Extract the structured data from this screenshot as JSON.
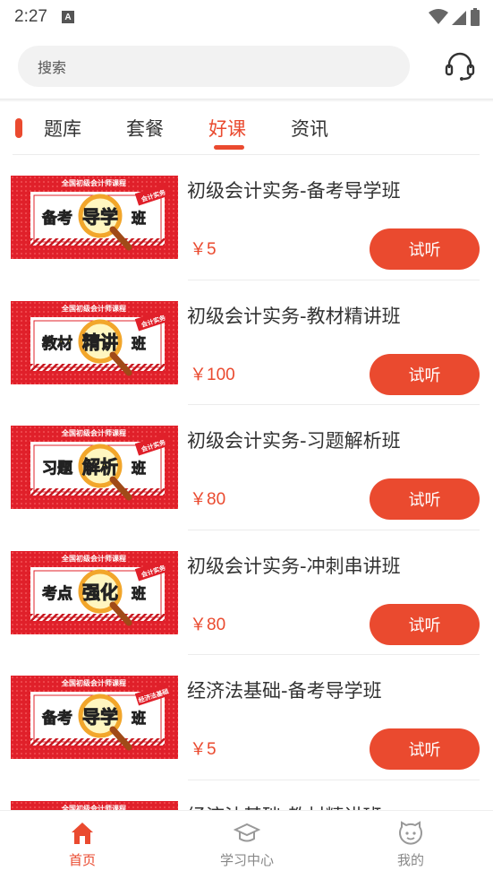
{
  "status_bar": {
    "time": "2:27",
    "notif_letter": "A"
  },
  "search": {
    "placeholder": "搜索"
  },
  "tabs": [
    {
      "label": "题库",
      "active": false
    },
    {
      "label": "套餐",
      "active": false
    },
    {
      "label": "好课",
      "active": true
    },
    {
      "label": "资讯",
      "active": false
    }
  ],
  "courses": [
    {
      "title": "初级会计实务-备考导学班",
      "price": "￥5",
      "button": "试听",
      "thumb": {
        "header": "全国初级会计师课程",
        "tag": "会计实务",
        "left": "备考",
        "center": "导学",
        "right": "班"
      }
    },
    {
      "title": "初级会计实务-教材精讲班",
      "price": "￥100",
      "button": "试听",
      "thumb": {
        "header": "全国初级会计师课程",
        "tag": "会计实务",
        "left": "教材",
        "center": "精讲",
        "right": "班"
      }
    },
    {
      "title": "初级会计实务-习题解析班",
      "price": "￥80",
      "button": "试听",
      "thumb": {
        "header": "全国初级会计师课程",
        "tag": "会计实务",
        "left": "习题",
        "center": "解析",
        "right": "班"
      }
    },
    {
      "title": "初级会计实务-冲刺串讲班",
      "price": "￥80",
      "button": "试听",
      "thumb": {
        "header": "全国初级会计师课程",
        "tag": "会计实务",
        "left": "考点",
        "center": "强化",
        "right": "班"
      }
    },
    {
      "title": "经济法基础-备考导学班",
      "price": "￥5",
      "button": "试听",
      "thumb": {
        "header": "全国初级会计师课程",
        "tag": "经济法基础",
        "left": "备考",
        "center": "导学",
        "right": "班"
      }
    },
    {
      "title": "经济法基础-教材精讲班",
      "price": "",
      "button": "",
      "thumb": {
        "header": "全国初级会计师课程",
        "tag": "",
        "left": "",
        "center": "",
        "right": ""
      }
    }
  ],
  "bottom_nav": [
    {
      "label": "首页",
      "icon": "home-icon",
      "active": true
    },
    {
      "label": "学习中心",
      "icon": "graduation-cap-icon",
      "active": false
    },
    {
      "label": "我的",
      "icon": "profile-face-icon",
      "active": false
    }
  ],
  "colors": {
    "accent": "#ea4a2f",
    "thumb_red": "#e0202a",
    "thumb_yellow": "#f7e04a"
  }
}
